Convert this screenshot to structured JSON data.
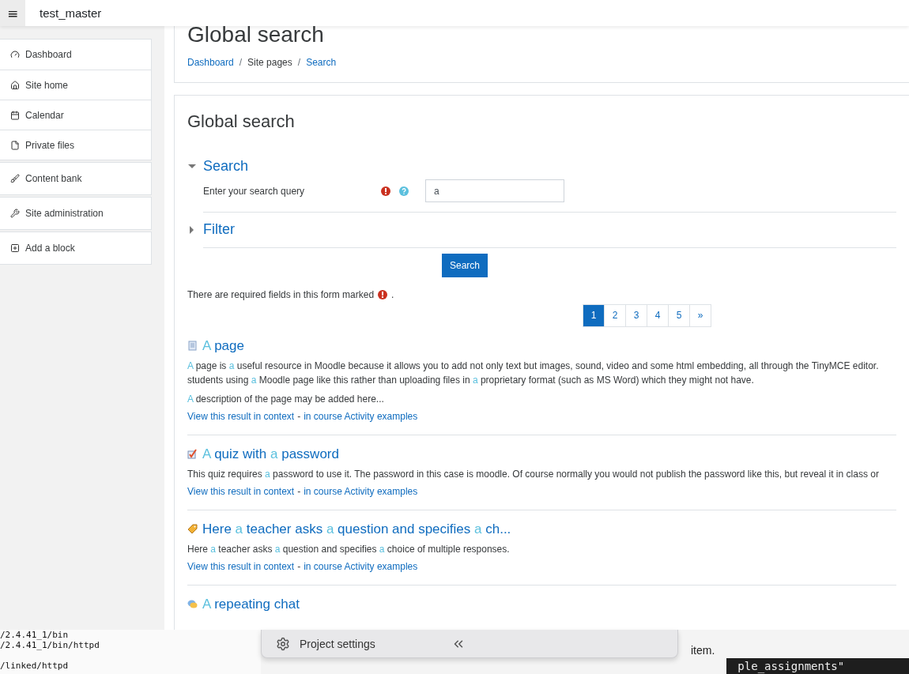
{
  "navbar": {
    "menu_icon": "≡",
    "site_name": "test_master"
  },
  "sidebar": {
    "groups": [
      {
        "items": [
          {
            "label": "Dashboard"
          },
          {
            "label": "Site home"
          },
          {
            "label": "Calendar"
          },
          {
            "label": "Private files"
          }
        ]
      },
      {
        "items": [
          {
            "label": "Content bank"
          }
        ]
      },
      {
        "items": [
          {
            "label": "Site administration"
          }
        ]
      },
      {
        "items": [
          {
            "label": "Add a block"
          }
        ]
      }
    ]
  },
  "header": {
    "title": "Global search",
    "separator": "/",
    "breadcrumbs": [
      {
        "label": "Dashboard",
        "link": true
      },
      {
        "label": "Site pages",
        "link": false
      },
      {
        "label": "Search",
        "link": true
      }
    ]
  },
  "form": {
    "title": "Global search",
    "sections": [
      {
        "title": "Search",
        "expanded": true,
        "fields": [
          {
            "label": "Enter your search query",
            "required": true,
            "help": true,
            "value": "a"
          }
        ]
      },
      {
        "title": "Filter",
        "expanded": false
      }
    ],
    "submit": "Search",
    "required_note": "There are required fields in this form marked",
    "required_note_end": "."
  },
  "pagination": [
    {
      "label": "1",
      "selected": true
    },
    {
      "label": "2",
      "selected": false
    },
    {
      "label": "3",
      "selected": false
    },
    {
      "label": "4",
      "selected": false
    },
    {
      "label": "5",
      "selected": false
    },
    {
      "label": "»",
      "selected": false
    }
  ],
  "results": [
    {
      "kind": "page",
      "title": [
        {
          "t": "A",
          "hl": true
        },
        {
          "t": " page",
          "hl": false
        }
      ],
      "paragraphs": [
        [
          {
            "t": "A",
            "hl": true
          },
          {
            "t": " page is ",
            "hl": false
          },
          {
            "t": "a",
            "hl": true
          },
          {
            "t": " useful resource in Moodle because it allows you to add not only text but images, sound, video and some html embedding, all through the TinyMCE editor.",
            "hl": false
          }
        ],
        [
          {
            "t": "students using ",
            "hl": false
          },
          {
            "t": "a",
            "hl": true
          },
          {
            "t": " Moodle page like this rather than uploading files in ",
            "hl": false
          },
          {
            "t": "a",
            "hl": true
          },
          {
            "t": " proprietary format (such as MS Word) which they might not have.",
            "hl": false
          }
        ],
        [
          {
            "t": "A",
            "hl": true
          },
          {
            "t": " description of the page may be added here...",
            "hl": false
          }
        ]
      ],
      "context_link": "View this result in context",
      "separator": "-",
      "course_link": "in course Activity examples"
    },
    {
      "kind": "quiz",
      "title": [
        {
          "t": "A",
          "hl": true
        },
        {
          "t": " quiz with ",
          "hl": false
        },
        {
          "t": "a",
          "hl": true
        },
        {
          "t": " password",
          "hl": false
        }
      ],
      "paragraphs": [
        [
          {
            "t": "This quiz requires ",
            "hl": false
          },
          {
            "t": "a",
            "hl": true
          },
          {
            "t": " password to use it. The password in this case is moodle. Of course normally you would not publish the password like this, but reveal it in class or",
            "hl": false
          }
        ]
      ],
      "context_link": "View this result in context",
      "separator": "-",
      "course_link": "in course Activity examples"
    },
    {
      "kind": "choice",
      "title": [
        {
          "t": "Here ",
          "hl": false
        },
        {
          "t": "a",
          "hl": true
        },
        {
          "t": " teacher asks ",
          "hl": false
        },
        {
          "t": "a",
          "hl": true
        },
        {
          "t": " question and specifies ",
          "hl": false
        },
        {
          "t": "a",
          "hl": true
        },
        {
          "t": " ch...",
          "hl": false
        }
      ],
      "paragraphs": [
        [
          {
            "t": "Here ",
            "hl": false
          },
          {
            "t": "a",
            "hl": true
          },
          {
            "t": " teacher asks ",
            "hl": false
          },
          {
            "t": "a",
            "hl": true
          },
          {
            "t": " question and specifies ",
            "hl": false
          },
          {
            "t": "a",
            "hl": true
          },
          {
            "t": " choice of multiple responses.",
            "hl": false
          }
        ]
      ],
      "context_link": "View this result in context",
      "separator": "-",
      "course_link": "in course Activity examples"
    },
    {
      "kind": "chat",
      "title": [
        {
          "t": "A",
          "hl": true
        },
        {
          "t": " repeating chat",
          "hl": false
        }
      ]
    }
  ],
  "overlay": {
    "terminal_lines": [
      "/2.4.41_1/bin",
      "/2.4.41_1/bin/httpd",
      "/linked/httpd"
    ],
    "panel_title": "Project settings",
    "panel_text": "item.",
    "code_text": "ple_assignments\""
  }
}
